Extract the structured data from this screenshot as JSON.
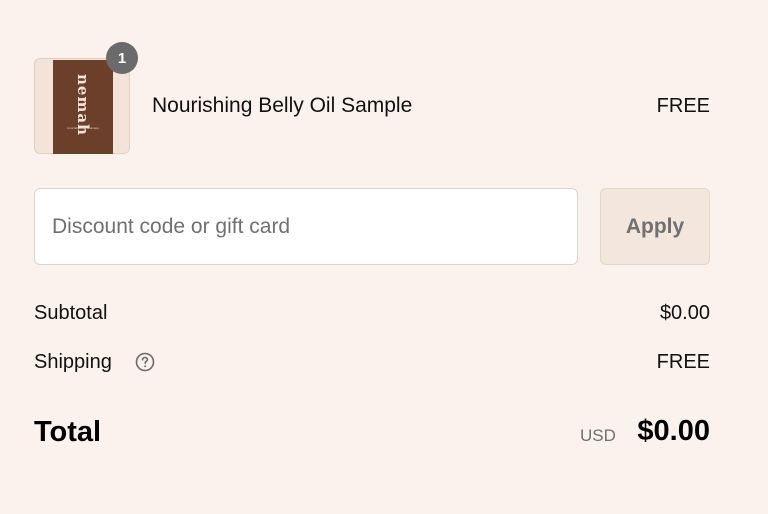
{
  "line_item": {
    "quantity_badge": "1",
    "thumbnail_brand": "nemah",
    "thumbnail_subtext": "nourish belly therapy",
    "title": "Nourishing Belly Oil Sample",
    "price": "FREE"
  },
  "discount": {
    "placeholder": "Discount code or gift card",
    "value": "",
    "apply_label": "Apply"
  },
  "summary": {
    "subtotal_label": "Subtotal",
    "subtotal_value": "$0.00",
    "shipping_label": "Shipping",
    "shipping_value": "FREE",
    "shipping_help_icon": "question-circle-icon",
    "total_label": "Total",
    "total_currency": "USD",
    "total_value": "$0.00"
  },
  "colors": {
    "background": "#fbf2ed",
    "apply_button_bg": "#f3e6dc",
    "badge_bg": "#6b6b6b",
    "product_box": "#6b3f2a"
  }
}
